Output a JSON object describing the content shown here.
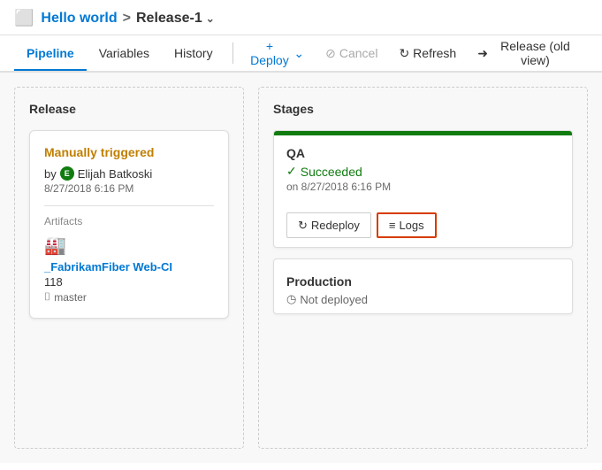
{
  "header": {
    "icon": "⊞",
    "breadcrumb": {
      "parent": "Hello world",
      "separator": ">",
      "current": "Release-1"
    }
  },
  "tabs": [
    {
      "id": "pipeline",
      "label": "Pipeline",
      "active": true
    },
    {
      "id": "variables",
      "label": "Variables",
      "active": false
    },
    {
      "id": "history",
      "label": "History",
      "active": false
    }
  ],
  "actions": {
    "deploy": "+ Deploy",
    "cancel": "Cancel",
    "refresh": "Refresh",
    "old_view": "Release (old view)"
  },
  "release_panel": {
    "title": "Release",
    "card": {
      "trigger": "Manually triggered",
      "by": "by",
      "user": "Elijah Batkoski",
      "timestamp": "8/27/2018 6:16 PM",
      "artifacts_label": "Artifacts",
      "artifact_name": "_FabrikamFiber Web-CI",
      "artifact_version": "118",
      "artifact_branch": "master"
    }
  },
  "stages_panel": {
    "title": "Stages",
    "stages": [
      {
        "id": "qa",
        "name": "QA",
        "status": "Succeeded",
        "status_type": "success",
        "timestamp": "on 8/27/2018 6:16 PM",
        "actions": [
          {
            "id": "redeploy",
            "label": "Redeploy",
            "highlighted": false
          },
          {
            "id": "logs",
            "label": "Logs",
            "highlighted": true
          }
        ]
      },
      {
        "id": "production",
        "name": "Production",
        "status": "Not deployed",
        "status_type": "pending",
        "timestamp": "",
        "actions": []
      }
    ]
  }
}
